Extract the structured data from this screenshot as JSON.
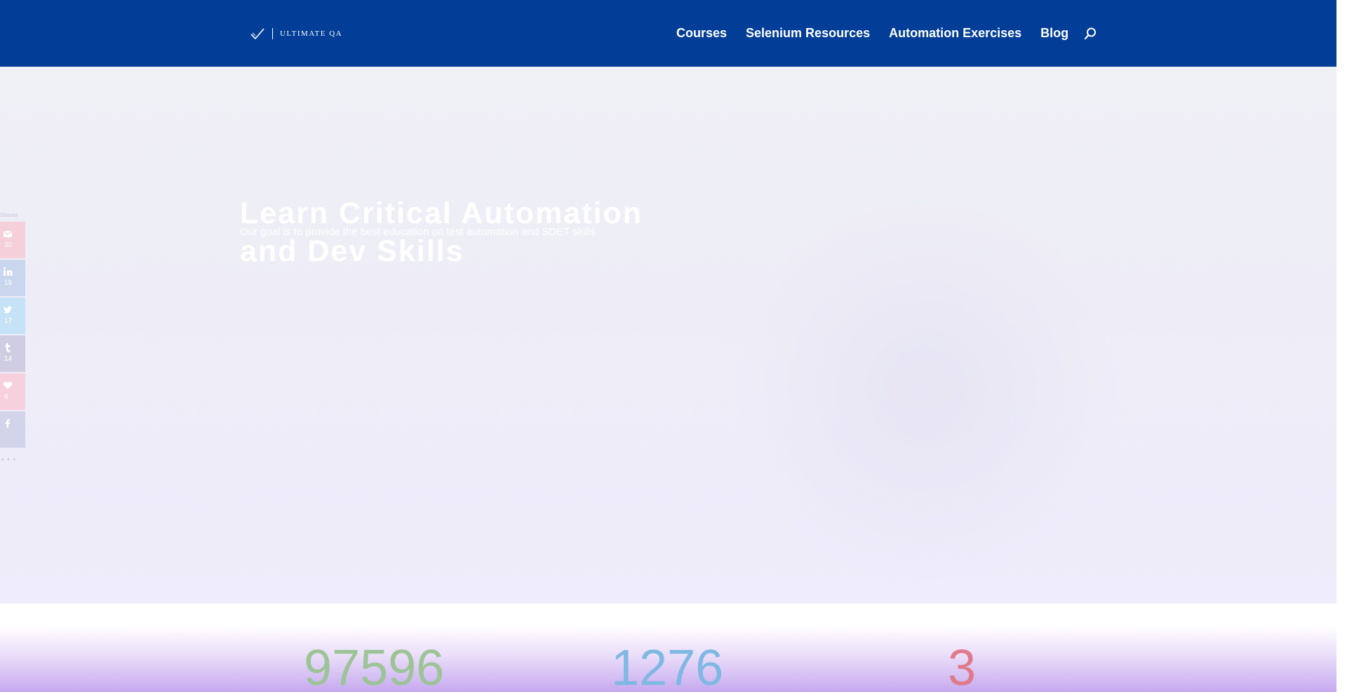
{
  "header": {
    "logo_text": "ULTIMATE QA",
    "nav": [
      "Courses",
      "Selenium Resources",
      "Automation Exercises",
      "Blog"
    ],
    "background": "#023e97"
  },
  "hero": {
    "title": "Learn Critical Automation and Dev Skills",
    "subtitle": "Our goal is to provide the best education on test automation and SDET skills"
  },
  "share": {
    "label": "Shares",
    "buttons": [
      {
        "network": "email",
        "icon": "mail-icon",
        "count": "30",
        "color": "#f5cfd9"
      },
      {
        "network": "linkedin",
        "icon": "linkedin-icon",
        "count": "19",
        "color": "#c9d6ee"
      },
      {
        "network": "twitter",
        "icon": "twitter-icon",
        "count": "17",
        "color": "#c6e2f6"
      },
      {
        "network": "tumblr",
        "icon": "tumblr-icon",
        "count": "14",
        "color": "#cfcde2"
      },
      {
        "network": "favorite",
        "icon": "heart-icon",
        "count": "6",
        "color": "#f6d0dd"
      },
      {
        "network": "facebook",
        "icon": "facebook-icon",
        "count": "",
        "color": "#d2d5ea"
      }
    ],
    "more": "• • •"
  },
  "stats": [
    {
      "value": "97596",
      "color": "#9cc497"
    },
    {
      "value": "1276",
      "color": "#7fb8e2"
    },
    {
      "value": "3",
      "color": "#e07a8a"
    }
  ]
}
